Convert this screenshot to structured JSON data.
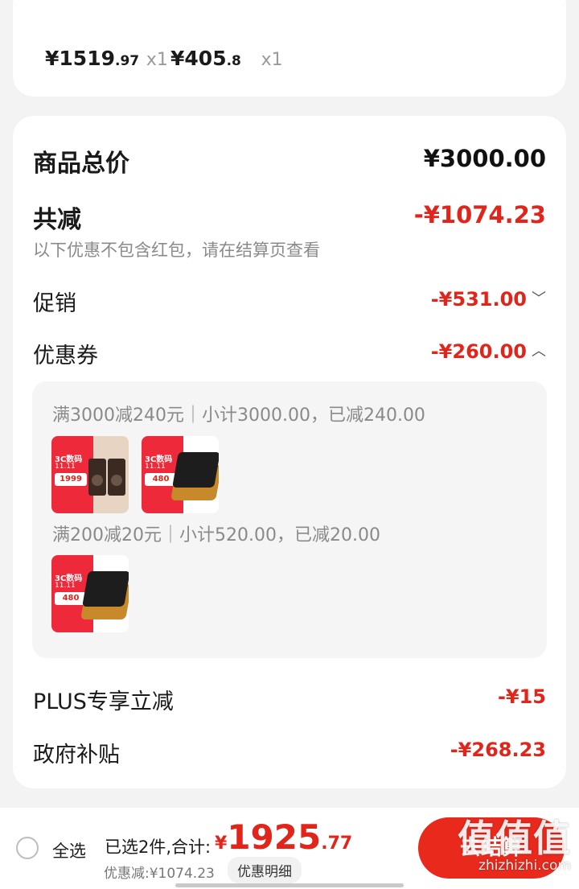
{
  "top_items": [
    {
      "currency": "¥",
      "price_int": "1519",
      "price_dec": ".97",
      "qty": "x1"
    },
    {
      "currency": "¥",
      "price_int": "405",
      "price_dec": ".8",
      "qty": "x1"
    }
  ],
  "summary": {
    "total_label": "商品总价",
    "total_value": "¥3000.00",
    "reduced_label": "共减",
    "reduced_value": "-¥1074.23",
    "note": "以下优惠不包含红包，请在结算页查看",
    "promo_label": "促销",
    "promo_value": "-¥531.00",
    "coupon_label": "优惠券",
    "coupon_value": "-¥260.00",
    "plus_label": "PLUS专享立减",
    "plus_value": "-¥15",
    "gov_label": "政府补贴",
    "gov_value": "-¥268.23"
  },
  "coupon_details": [
    {
      "text": "满3000减240元｜小计3000.00，已减240.00",
      "products": [
        "speakers",
        "cd-player"
      ]
    },
    {
      "text": "满200减20元｜小计520.00，已减20.00",
      "products": [
        "cd-player"
      ]
    }
  ],
  "product_thumbs": {
    "speakers": {
      "badge": "3C数码",
      "date": "11.11",
      "price": "1999"
    },
    "cd-player": {
      "badge": "3C数码",
      "date": "11.11",
      "price": "480"
    }
  },
  "bottom_bar": {
    "select_all": "全选",
    "selected_text": "已选2件,合计:",
    "total_currency": "¥",
    "total_int": "1925",
    "total_dec": ".77",
    "discount_text": "优惠减:¥1074.23",
    "detail_button": "优惠明细",
    "checkout_button": "去结算"
  },
  "watermark": {
    "main": "值值值",
    "site": "zhizhizhi.com"
  },
  "colors": {
    "accent_red": "#e1251b",
    "checkout_red": "#e8291c",
    "background": "#f3f3f3"
  },
  "icons": {
    "promo_toggle": "chevron-down-icon",
    "coupon_toggle": "chevron-up-icon",
    "select_all": "radio-unchecked-icon"
  }
}
